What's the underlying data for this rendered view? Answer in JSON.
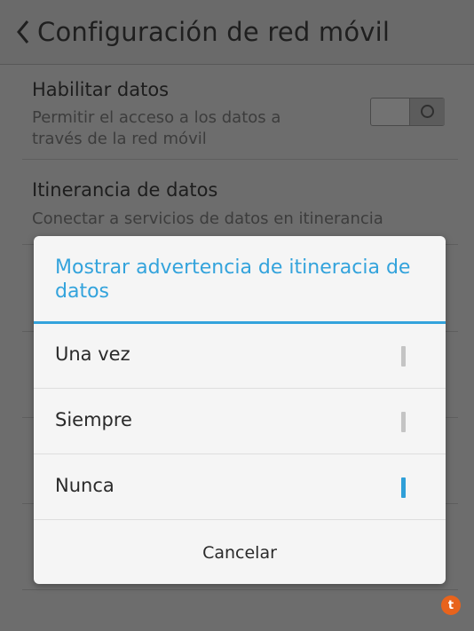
{
  "header": {
    "title": "Configuración de red móvil",
    "back_icon": "chevron-left-icon"
  },
  "settings": [
    {
      "title": "Habilitar datos",
      "summary": "Permitir el acceso a los datos a través de la red móvil",
      "toggle": "off"
    },
    {
      "title": "Itinerancia de datos",
      "summary": "Conectar a servicios de datos en itinerancia"
    }
  ],
  "dialog": {
    "title": "Mostrar advertencia de itineracia de datos",
    "options": [
      {
        "label": "Una vez",
        "selected": false
      },
      {
        "label": "Siempre",
        "selected": false
      },
      {
        "label": "Nunca",
        "selected": true
      }
    ],
    "cancel_label": "Cancelar"
  },
  "badge": {
    "text": "t",
    "color": "#e8631c"
  },
  "colors": {
    "accent": "#33a3dc",
    "dim_background": "#6d6d6d",
    "dialog_background": "#f5f5f5"
  }
}
